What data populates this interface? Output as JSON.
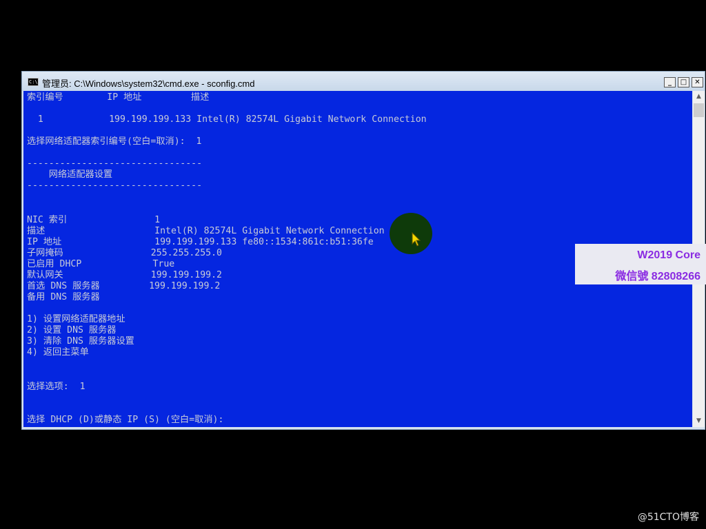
{
  "window": {
    "title": "管理员: C:\\Windows\\system32\\cmd.exe - sconfig.cmd",
    "icon": "cmd-icon",
    "icon_text": "C:\\",
    "minimize_label": "_",
    "maximize_label": "□",
    "close_label": "✕"
  },
  "console": {
    "background_color": "#0526e0",
    "text_color": "#c8cbd8",
    "lines": [
      "索引编号        IP 地址         描述",
      "",
      "  1            199.199.199.133 Intel(R) 82574L Gigabit Network Connection",
      "",
      "选择网络适配器索引编号(空白=取消):  1",
      "",
      "--------------------------------",
      "    网络适配器设置",
      "--------------------------------",
      "",
      "",
      "NIC 索引                1",
      "描述                    Intel(R) 82574L Gigabit Network Connection",
      "IP 地址                 199.199.199.133 fe80::1534:861c:b51:36fe",
      "子网掩码                255.255.255.0",
      "已启用 DHCP             True",
      "默认网关                199.199.199.2",
      "首选 DNS 服务器         199.199.199.2",
      "备用 DNS 服务器",
      "",
      "1) 设置网络适配器地址",
      "2) 设置 DNS 服务器",
      "3) 清除 DNS 服务器设置",
      "4) 返回主菜单",
      "",
      "",
      "选择选项:  1",
      "",
      "",
      "选择 DHCP (D)或静态 IP (S) (空白=取消):"
    ]
  },
  "scrollbar": {
    "up_arrow": "▲",
    "down_arrow": "▼"
  },
  "watermark": {
    "line1": "W2019 Core",
    "line2": "微信號 82808266",
    "color": "#8a2be2"
  },
  "footer": {
    "credit": "@51CTO博客"
  }
}
